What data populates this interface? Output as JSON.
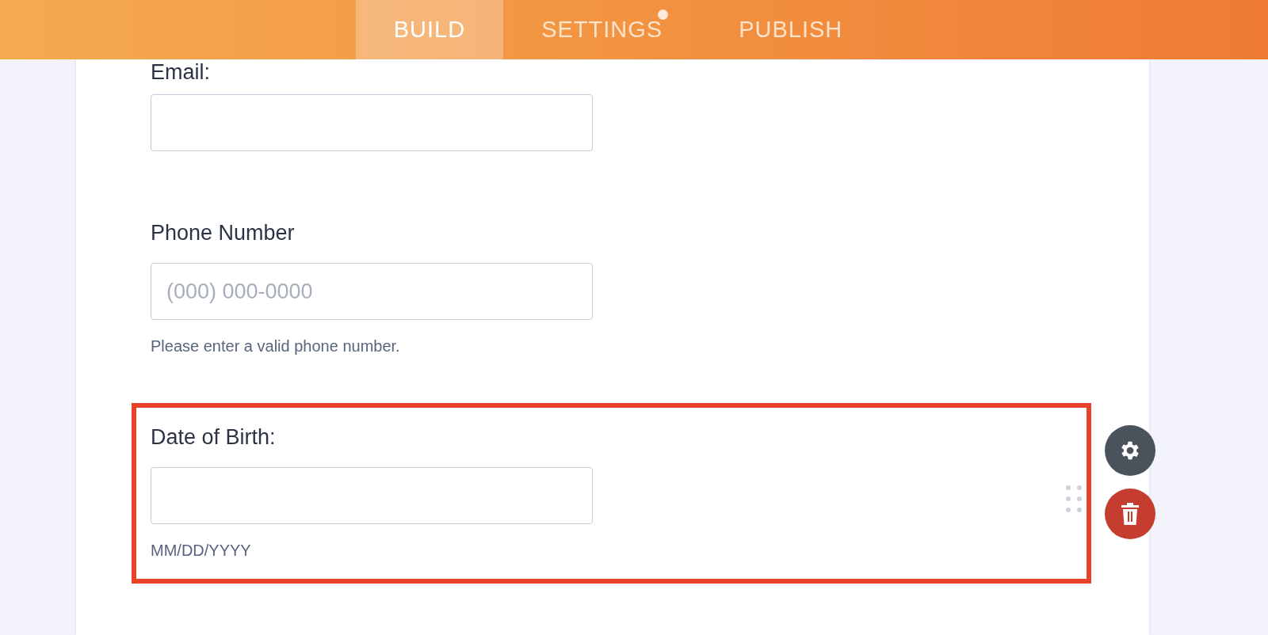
{
  "tabs": [
    {
      "label": "BUILD",
      "selected": true,
      "dot": false
    },
    {
      "label": "SETTINGS",
      "selected": false,
      "dot": true
    },
    {
      "label": "PUBLISH",
      "selected": false,
      "dot": false
    }
  ],
  "fields": [
    {
      "label": "Email:",
      "selected": false
    },
    {
      "label": "Phone Number",
      "placeholder": "(000) 000-0000",
      "hint": "Please enter a valid phone number.",
      "selected": false
    },
    {
      "label": "Date of Birth:",
      "hint": "MM/DD/YYYY",
      "selected": true
    }
  ]
}
